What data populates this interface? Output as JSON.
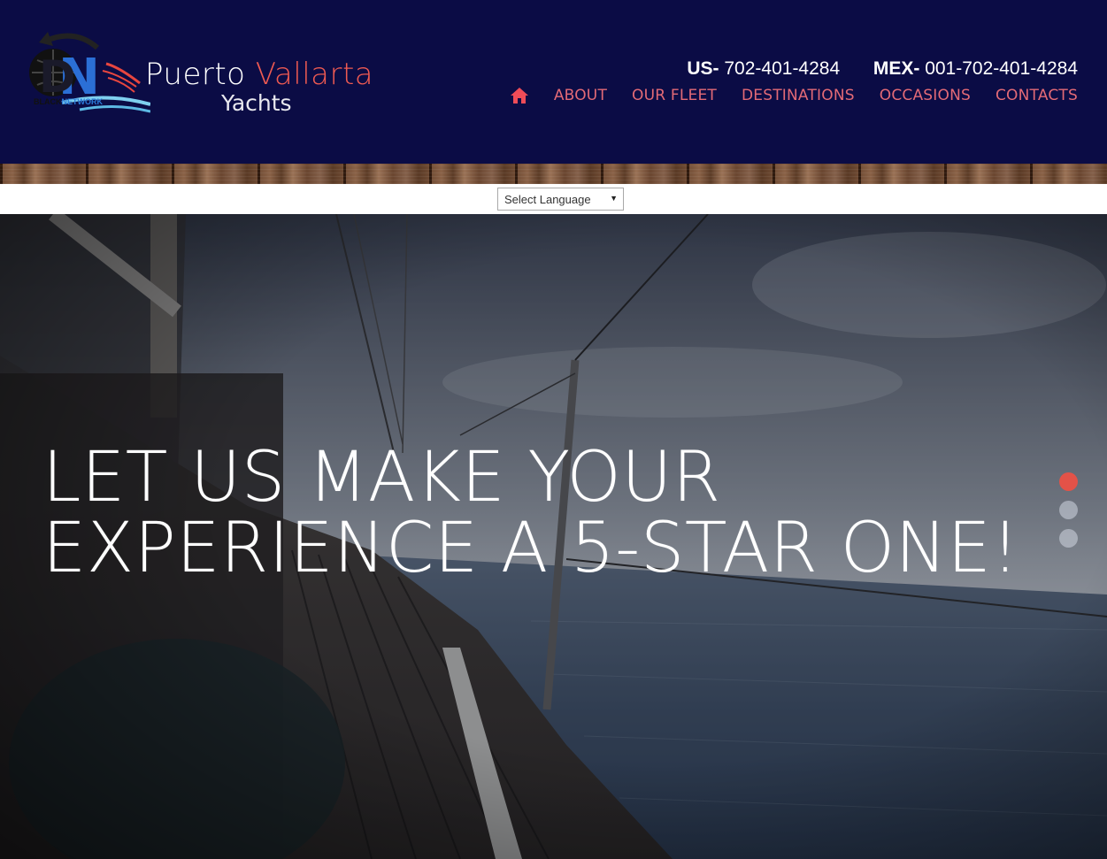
{
  "brand": {
    "title_part1": "Puerto",
    "title_part2": "Vallarta",
    "subtitle": "Yachts",
    "network_part1": "BLACK",
    "network_part2": "NETWORK",
    "accent_color": "#ef5a52",
    "header_bg": "#0b0c45"
  },
  "contacts": {
    "us_label": "US-",
    "us_number": "702-401-4284",
    "mex_label": "MEX-",
    "mex_number": "001-702-401-4284"
  },
  "nav": {
    "home_icon": "home-icon",
    "items": [
      {
        "label": "ABOUT"
      },
      {
        "label": "OUR FLEET"
      },
      {
        "label": "DESTINATIONS"
      },
      {
        "label": "OCCASIONS"
      },
      {
        "label": "CONTACTS"
      }
    ],
    "color": "#e36a76"
  },
  "language": {
    "selected": "Select Language"
  },
  "hero": {
    "headline_line1": "LET US MAKE YOUR",
    "headline_line2": "EXPERIENCE A 5-STAR ONE!",
    "slides_total": 3,
    "active_slide": 1,
    "active_color": "#e35248"
  }
}
